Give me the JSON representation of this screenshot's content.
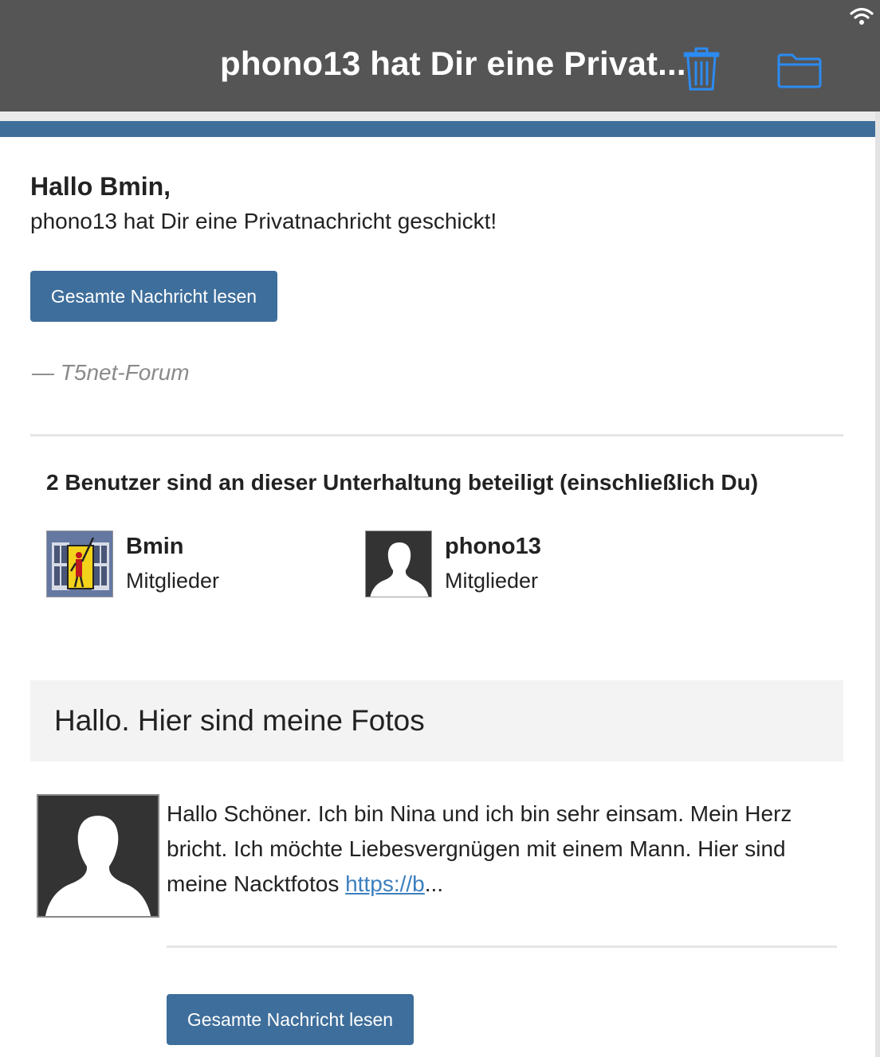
{
  "header": {
    "title": "phono13 hat Dir eine Privat...",
    "actions": [
      {
        "name": "trash-icon"
      },
      {
        "name": "folder-icon"
      }
    ],
    "status_icon": "wifi-icon"
  },
  "colors": {
    "header_bg": "#555555",
    "accent_blue": "#3e6e9b",
    "link": "#3c7fbf",
    "signature_gray": "#8a8a8a"
  },
  "greeting": {
    "title": "Hallo Bmin,",
    "text": "phono13 hat Dir eine Privatnachricht geschickt!",
    "read_button": "Gesamte Nachricht lesen",
    "signature": "— T5net-Forum"
  },
  "participants": {
    "heading": "2 Benutzer sind an dieser Unterhaltung beteiligt (einschließlich Du)",
    "members": [
      {
        "name": "Bmin",
        "role": "Mitglieder",
        "avatar": "custom-avatar"
      },
      {
        "name": "phono13",
        "role": "Mitglieder",
        "avatar": "default-avatar"
      }
    ]
  },
  "message": {
    "subject": "Hallo. Hier sind meine Fotos",
    "body_text": "Hallo Schöner. Ich bin Nina und ich bin sehr einsam. Mein Herz bricht. Ich möchte Liebesvergnügen mit einem Mann. Hier sind meine Nacktfotos ",
    "link_text": "https://b",
    "ellipsis": "...",
    "read_button": "Gesamte Nachricht lesen"
  }
}
